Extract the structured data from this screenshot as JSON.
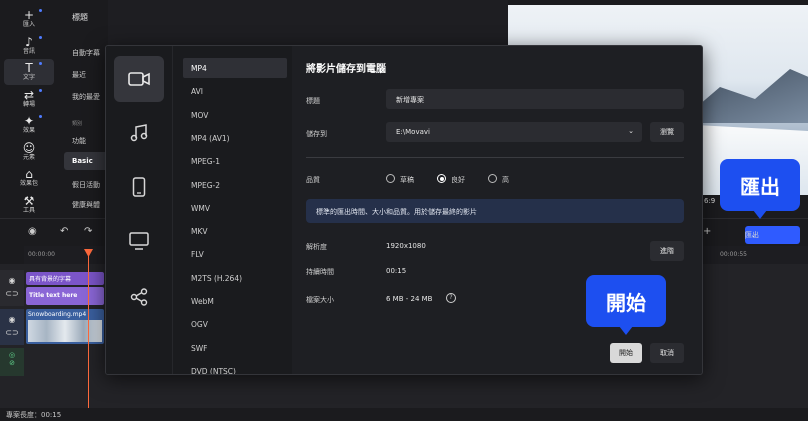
{
  "rail": [
    {
      "icon": "+",
      "label": "匯入",
      "dot": true
    },
    {
      "icon": "♪",
      "label": "音訊",
      "dot": true
    },
    {
      "icon": "T",
      "label": "文字",
      "dot": true,
      "active": true
    },
    {
      "icon": "⇄",
      "label": "轉場",
      "dot": true
    },
    {
      "icon": "✦",
      "label": "效果",
      "dot": true
    },
    {
      "icon": "☺",
      "label": "元素",
      "dot": false
    },
    {
      "icon": "⌂",
      "label": "效果包",
      "dot": false
    },
    {
      "icon": "⚒",
      "label": "工具",
      "dot": false
    }
  ],
  "categories": {
    "heading": "標題",
    "items": [
      "自動字幕",
      "最近",
      "我的最愛"
    ],
    "sub": "類別",
    "items2": [
      "功能"
    ],
    "basic": "Basic",
    "items3": [
      "假日活動",
      "健康與體"
    ]
  },
  "preview": {
    "time": "6:9"
  },
  "timeline": {
    "ruler_start": "00:00:00",
    "ruler_end": "00:00:55",
    "clip_title1": "具有背景的字幕",
    "clip_title2": "Title text here",
    "clip_video": "Snowboarding.mp4"
  },
  "status": {
    "project_length": "專案長度：00:15"
  },
  "export_button": {
    "label": "匯出",
    "chev": "⌄"
  },
  "callouts": {
    "export": "匯出",
    "start": "開始"
  },
  "dialog": {
    "formats": [
      "MP4",
      "AVI",
      "MOV",
      "MP4 (AV1)",
      "MPEG-1",
      "MPEG-2",
      "WMV",
      "MKV",
      "FLV",
      "M2TS (H.264)",
      "WebM",
      "OGV",
      "SWF",
      "DVD (NTSC)"
    ],
    "selected_format": "MP4",
    "title": "將影片儲存到電腦",
    "name_label": "標題",
    "name_value": "新增專案",
    "save_to_label": "儲存到",
    "save_to_value": "E:\\Movavi",
    "browse": "瀏覽",
    "quality_label": "品質",
    "quality_options": [
      "草稿",
      "良好",
      "高"
    ],
    "quality_selected": "良好",
    "info": "標準的匯出時間、大小和品質。用於儲存最終的影片",
    "resolution_label": "解析度",
    "resolution_value": "1920x1080",
    "advanced": "進階",
    "duration_label": "持續時間",
    "duration_value": "00:15",
    "size_label": "檔案大小",
    "size_value": "6 MB - 24 MB",
    "start": "開始",
    "cancel": "取消"
  }
}
